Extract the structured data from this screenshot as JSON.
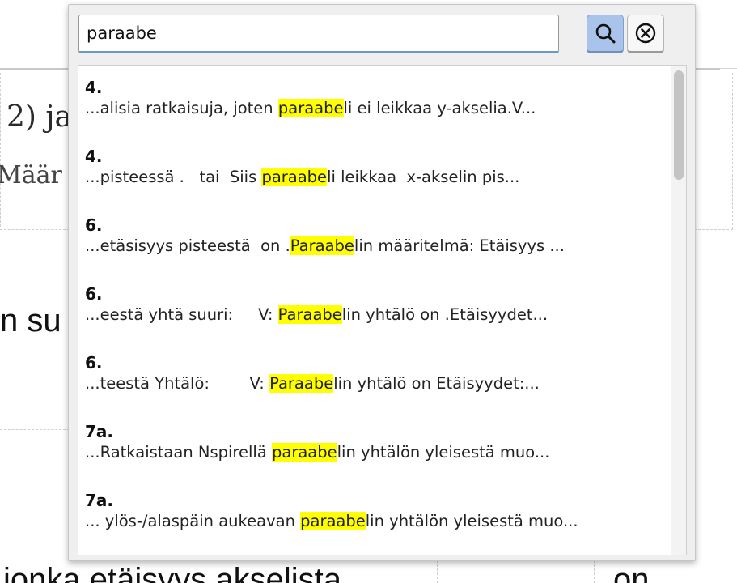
{
  "background": {
    "fragments": [
      "2) ja",
      "Määr",
      "n su",
      "jonka etäisyys akselista",
      "on"
    ]
  },
  "search": {
    "query": "paraabe",
    "search_button_icon": "magnifier-icon",
    "clear_button_icon": "circle-x-icon"
  },
  "results": [
    {
      "title": "4.",
      "before": "...alisia ratkaisuja, joten ",
      "match": "paraabe",
      "after": "li ei leikkaa y-akselia.V..."
    },
    {
      "title": "4.",
      "before": "...pisteessä .   tai  Siis ",
      "match": "paraabe",
      "after": "li leikkaa  x-akselin pis..."
    },
    {
      "title": "6.",
      "before": "...etäsisyys pisteestä  on .",
      "match": "Paraabe",
      "after": "lin määritelmä: Etäisyys ..."
    },
    {
      "title": "6.",
      "before": "...eestä yhtä suuri:     V: ",
      "match": "Paraabe",
      "after": "lin yhtälö on .Etäisyydet..."
    },
    {
      "title": "6.",
      "before": "...teestä Yhtälö:        V: ",
      "match": "Paraabe",
      "after": "lin yhtälö on Etäisyydet:..."
    },
    {
      "title": "7a.",
      "before": "...Ratkaistaan Nspirellä ",
      "match": "paraabe",
      "after": "lin yhtälön yleisestä muo..."
    },
    {
      "title": "7a.",
      "before": "... ylös-/alaspäin aukeavan ",
      "match": "paraabe",
      "after": "lin yhtälön yleisestä muo..."
    }
  ],
  "colors": {
    "highlight": "#ffff00",
    "search_button": "#a9c3ea",
    "input_focus": "#6f96c9"
  }
}
